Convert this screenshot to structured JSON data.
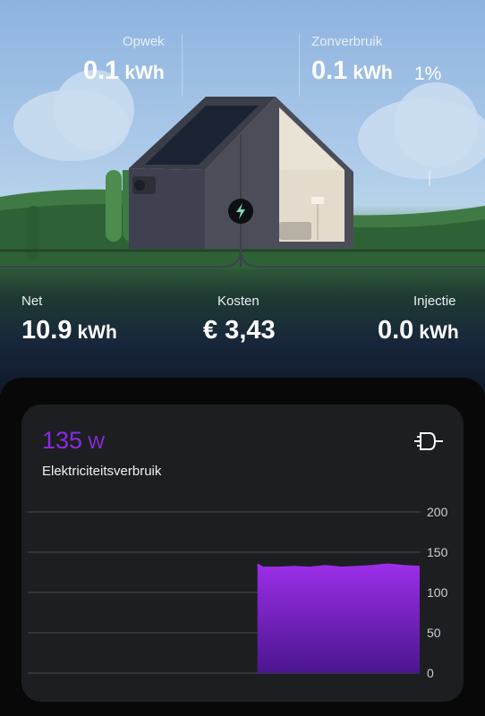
{
  "top_stats": {
    "opwek": {
      "label": "Opwek",
      "value": "0.1",
      "unit": "kWh"
    },
    "zonverbruik": {
      "label": "Zonverbruik",
      "value": "0.1",
      "unit": "kWh",
      "percent": "1%"
    }
  },
  "bottom_stats": {
    "net": {
      "label": "Net",
      "value": "10.9",
      "unit": "kWh"
    },
    "kosten": {
      "label": "Kosten",
      "value": "€ 3,43"
    },
    "injectie": {
      "label": "Injectie",
      "value": "0.0",
      "unit": "kWh"
    }
  },
  "card": {
    "power_value": "135",
    "power_unit": "W",
    "title": "Elektriciteitsverbruik",
    "icon": "plug-icon"
  },
  "colors": {
    "accent": "#8a2be2",
    "fill_top": "#9b2ee8",
    "fill_bottom": "#4b168f"
  },
  "chart_data": {
    "type": "area",
    "ylim": [
      0,
      200
    ],
    "yticks": [
      "200",
      "150",
      "100",
      "50",
      "0"
    ],
    "ytick_values": [
      200,
      150,
      100,
      50,
      0
    ],
    "x_domain": [
      0,
      100
    ],
    "grid": true,
    "series": [
      {
        "x": [
          58.6,
          60,
          64,
          68,
          72,
          76,
          80,
          84,
          88,
          92,
          96,
          100
        ],
        "values": [
          135,
          131,
          131,
          132,
          131,
          133,
          131,
          132,
          133,
          135,
          133,
          132
        ]
      }
    ]
  }
}
